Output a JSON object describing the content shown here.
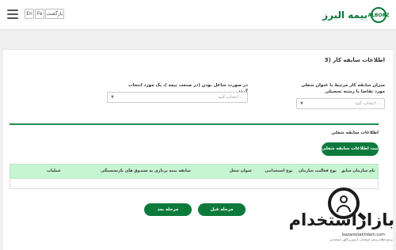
{
  "header": {
    "logo_text": "بیمه البرز",
    "logo_mark": "ALBORZ",
    "lang_en": "En",
    "lang_fa": "Fa",
    "back_label": "بازگشت"
  },
  "section": {
    "title": "3) اطلاعات سابقه کار"
  },
  "form": {
    "experience_label": "میزان سابقه کار مرتبط با عنوان شغلی مورد تقاضا یا رشته تحصیلی",
    "experience_placeholder": "انتخاب کنید ...",
    "insurance_label": "در صورت شاغل بودن (در صنعت بیمه )، یک مورد انتخاب گردد",
    "insurance_placeholder": "انتخاب کنید ..."
  },
  "jobs": {
    "subtitle": "اطلاعات سابقه شغلی",
    "add_button": "ثبت اطلاعات سابقه شغلی",
    "columns": [
      "نام سازمان سابق",
      "نوع فعالیت سازمان",
      "نوع استخدامی",
      "عنوان شغل",
      "سابقه بیمه پردازی به صندوق های بازنشستگی",
      "عملیات"
    ]
  },
  "nav": {
    "prev_label": "مرحله قبل",
    "next_label": "مرحله بعد"
  },
  "watermark": {
    "text": "بازاراستخدام",
    "url": "bazarestekhdam.com",
    "caption": "مرجع اطلاع رسانی استخدام ، آزمون و آگهی استخدامی"
  },
  "colors": {
    "brand_green": "#0d7a3b",
    "table_header": "#c6f5d1"
  }
}
